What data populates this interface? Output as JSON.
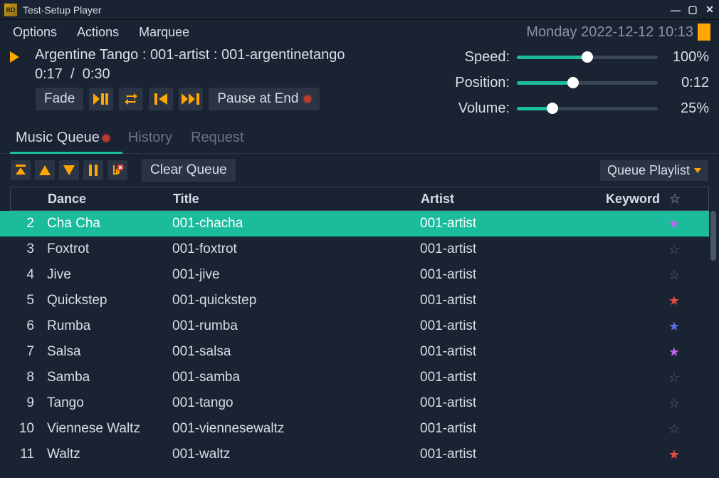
{
  "window": {
    "title": "Test-Setup Player"
  },
  "menu": {
    "options": "Options",
    "actions": "Actions",
    "marquee": "Marquee"
  },
  "datetime": "Monday 2022-12-12 10:13",
  "nowplaying": {
    "title": "Argentine Tango : 001-artist : 001-argentinetango",
    "elapsed": "0:17",
    "total": "0:30"
  },
  "sliders": {
    "speed": {
      "label": "Speed:",
      "value": "100%",
      "pct": 50
    },
    "position": {
      "label": "Position:",
      "value": "0:12",
      "pct": 40
    },
    "volume": {
      "label": "Volume:",
      "value": "25%",
      "pct": 25
    }
  },
  "transport": {
    "fade": "Fade",
    "pause_label_prefix": "Pause at End"
  },
  "tabs": {
    "queue": "Music Queue",
    "history": "History",
    "request": "Request"
  },
  "queue_toolbar": {
    "clear": "Clear Queue",
    "playlist": "Queue Playlist"
  },
  "columns": {
    "dance": "Dance",
    "title": "Title",
    "artist": "Artist",
    "keyword": "Keyword"
  },
  "rows": [
    {
      "n": "2",
      "dance": "Cha Cha",
      "title": "001-chacha",
      "artist": "001-artist",
      "star": "purple",
      "selected": true
    },
    {
      "n": "3",
      "dance": "Foxtrot",
      "title": "001-foxtrot",
      "artist": "001-artist",
      "star": "empty"
    },
    {
      "n": "4",
      "dance": "Jive",
      "title": "001-jive",
      "artist": "001-artist",
      "star": "empty"
    },
    {
      "n": "5",
      "dance": "Quickstep",
      "title": "001-quickstep",
      "artist": "001-artist",
      "star": "red"
    },
    {
      "n": "6",
      "dance": "Rumba",
      "title": "001-rumba",
      "artist": "001-artist",
      "star": "blue"
    },
    {
      "n": "7",
      "dance": "Salsa",
      "title": "001-salsa",
      "artist": "001-artist",
      "star": "purple"
    },
    {
      "n": "8",
      "dance": "Samba",
      "title": "001-samba",
      "artist": "001-artist",
      "star": "empty"
    },
    {
      "n": "9",
      "dance": "Tango",
      "title": "001-tango",
      "artist": "001-artist",
      "star": "empty"
    },
    {
      "n": "10",
      "dance": "Viennese Waltz",
      "title": "001-viennesewaltz",
      "artist": "001-artist",
      "star": "empty"
    },
    {
      "n": "11",
      "dance": "Waltz",
      "title": "001-waltz",
      "artist": "001-artist",
      "star": "red"
    }
  ],
  "star_glyphs": {
    "empty": "☆",
    "purple": "★",
    "red": "★",
    "blue": "★"
  }
}
